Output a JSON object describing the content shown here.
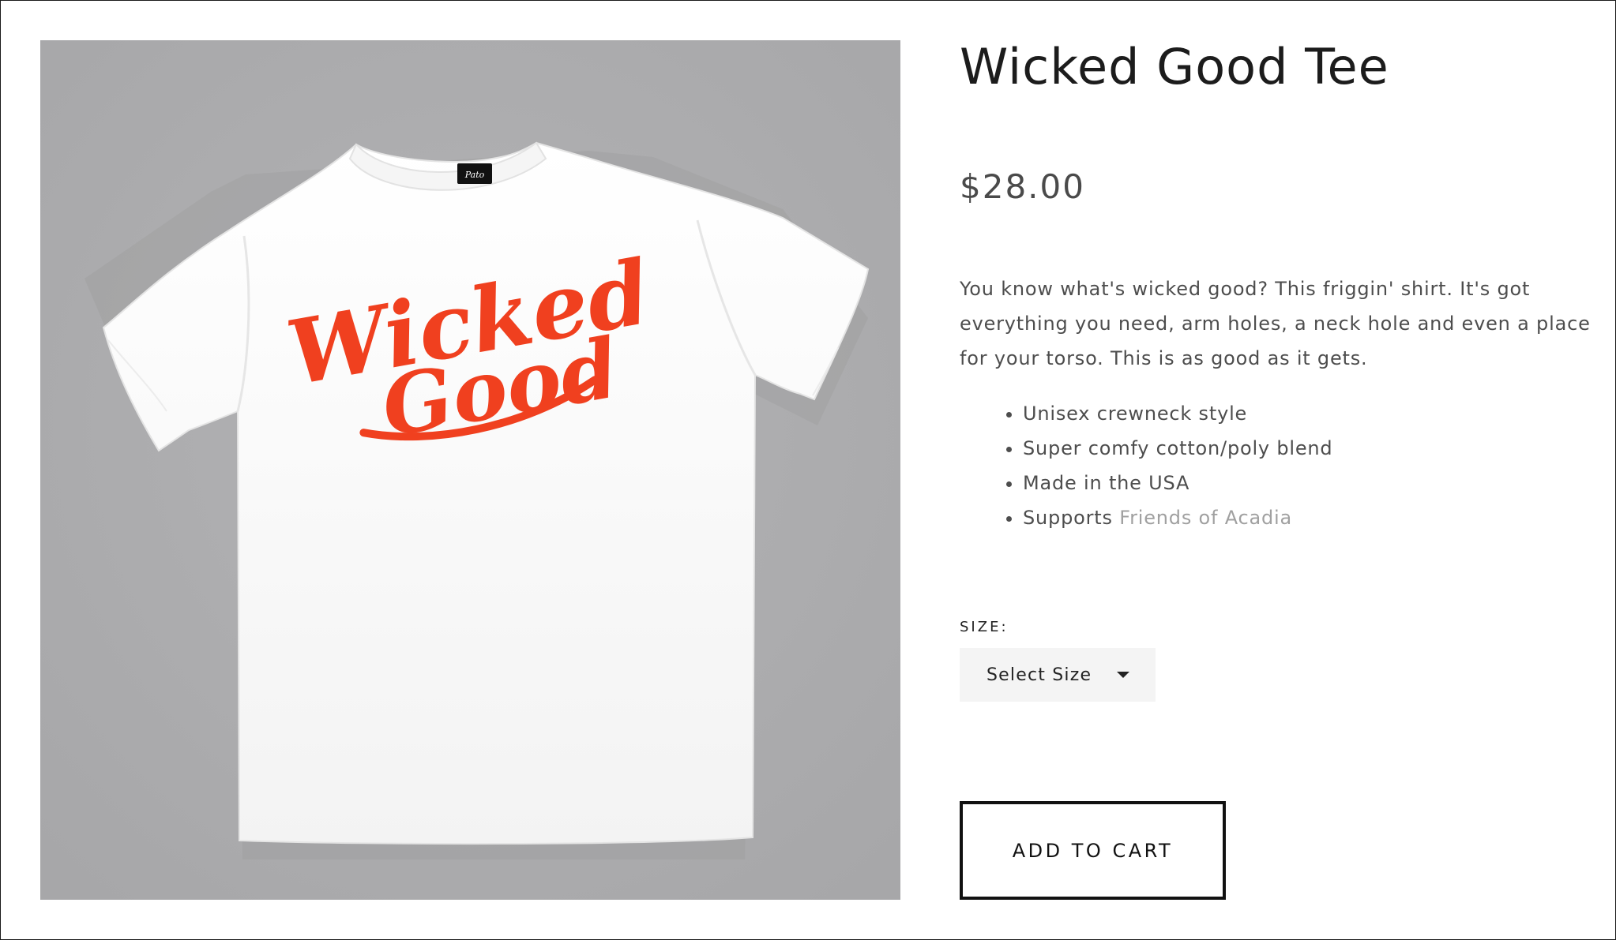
{
  "product": {
    "title": "Wicked Good Tee",
    "price": "$28.00",
    "image": {
      "alt": "White t-shirt with red Wicked Good script",
      "background_color": "#adadaf",
      "shirt_color": "#ffffff",
      "print_color": "#f0401f",
      "print_text_line1": "Wicked",
      "print_text_line2": "Good"
    },
    "description": "You know what's wicked good? This friggin' shirt. It's got everything you need, arm holes, a neck hole and even a place for your torso. This is as good as it gets.",
    "features": [
      {
        "text": "Unisex crewneck style"
      },
      {
        "text": "Super comfy cotton/poly blend"
      },
      {
        "text": "Made in the USA"
      },
      {
        "text": "Supports ",
        "link": "Friends of Acadia"
      }
    ]
  },
  "size": {
    "label": "SIZE:",
    "selected": "Select Size",
    "icon": "chevron-down-icon"
  },
  "cart": {
    "add_label": "ADD TO CART"
  },
  "colors": {
    "link": "#a0a0a0",
    "text": "#4d4d4d",
    "button_border": "#111111"
  }
}
